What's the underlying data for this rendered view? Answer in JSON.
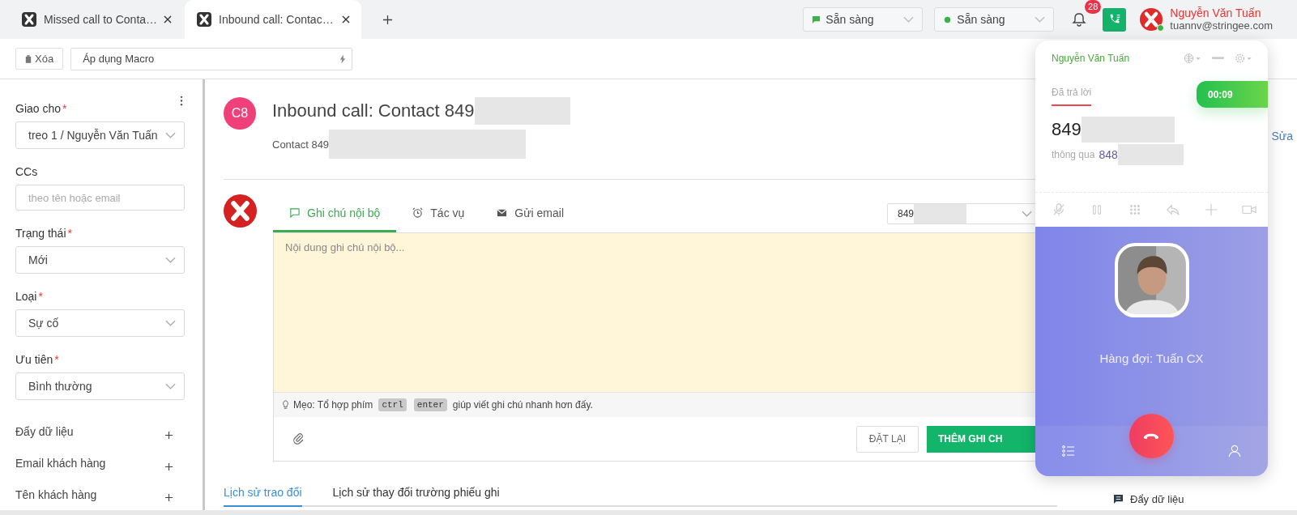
{
  "tabs": [
    {
      "label": "Missed call to Conta…",
      "selected": false
    },
    {
      "label": "Inbound call: Contac…",
      "selected": true
    }
  ],
  "header": {
    "status_selects": [
      {
        "kind": "chat",
        "label": "Sẵn sàng"
      },
      {
        "kind": "dot",
        "label": "Sẵn sàng"
      }
    ],
    "notification_count": "28",
    "user": {
      "name": "Nguyễn Văn Tuấn",
      "email": "tuannv@stringee.com",
      "online": true
    }
  },
  "toolbar": {
    "delete_button": "Xóa",
    "macro": {
      "placeholder": "Áp dụng Macro"
    }
  },
  "sidebar": {
    "fields": [
      {
        "label": "Giao cho",
        "required_mark": "*",
        "kind": "select",
        "value": "treo 1 / Nguyễn Văn Tuấn"
      },
      {
        "label": "CCs",
        "kind": "input",
        "placeholder": "theo tên hoặc email"
      },
      {
        "label": "Trạng thái",
        "required_mark": "*",
        "kind": "select",
        "value": "Mới"
      },
      {
        "label": "Loại",
        "required_mark": "*",
        "kind": "select",
        "value": "Sự cố"
      },
      {
        "label": "Ưu tiên",
        "required_mark": "*",
        "kind": "select",
        "value": "Bình thường"
      }
    ],
    "sections": [
      {
        "label": "Đẩy dữ liệu",
        "expanded": false
      },
      {
        "label": "Email khách hàng",
        "expanded": false
      },
      {
        "label": "Tên khách hàng",
        "expanded": false
      }
    ]
  },
  "ticket": {
    "avatar": "C8",
    "title": "Inbound call: Contact 849",
    "subtitle": "Contact 849"
  },
  "composer": {
    "tabs": [
      {
        "label": "Ghi chú nội bộ",
        "kind": "note",
        "selected": true
      },
      {
        "label": "Tác vụ",
        "kind": "task",
        "selected": false
      },
      {
        "label": "Gửi email",
        "kind": "email",
        "selected": false
      }
    ],
    "recipient": "849",
    "placeholder": "Nội dung ghi chú nội bộ...",
    "tip": {
      "prefix": "Mẹo: Tổ hợp phím",
      "keys": [
        "ctrl",
        "enter"
      ],
      "suffix": "giúp viết ghi chú nhanh hơn đấy."
    },
    "reset_button": "ĐẶT LẠI",
    "submit_button": "THÊM GHI CH"
  },
  "history_tabs": [
    {
      "label": "Lịch sử trao đổi",
      "selected": true
    },
    {
      "label": "Lịch sử thay đổi trường phiếu ghi",
      "selected": false
    }
  ],
  "right_panel": {
    "edit_link": "Sửa",
    "items": [
      {
        "label": "Đẩy dữ liệu"
      }
    ]
  },
  "softphone": {
    "agent": "Nguyễn Văn Tuấn",
    "status": "Đã trả lời",
    "timer": "00:09",
    "number": "849",
    "via_label": "thông qua",
    "via_number": "848",
    "queue": "Hàng đợi: Tuấn CX"
  }
}
